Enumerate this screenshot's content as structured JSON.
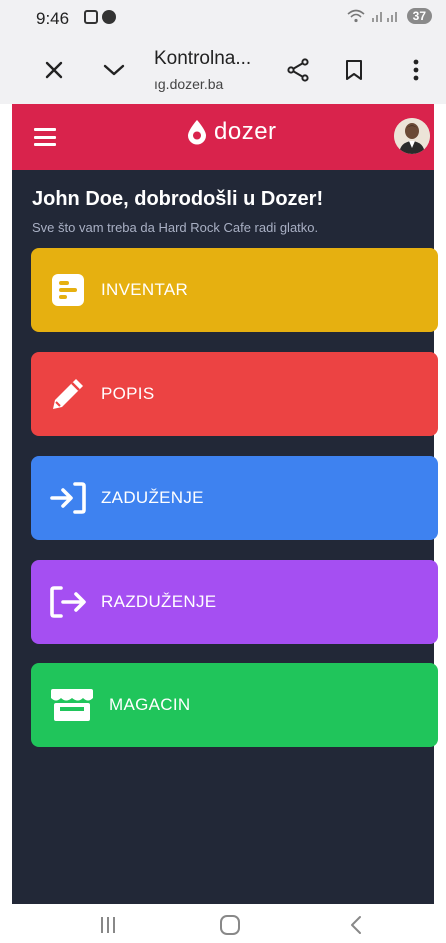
{
  "status_bar": {
    "time": "9:46",
    "battery": "37"
  },
  "browser": {
    "title": "Kontrolna...",
    "url": "ıg.dozer.ba",
    "icons": [
      "close-icon",
      "chevron-down-icon",
      "share-icon",
      "bookmark-icon",
      "more-vert-icon"
    ]
  },
  "app": {
    "logo_text": "dozer",
    "welcome": "John Doe, dobrodošli u Dozer!",
    "subtitle": "Sve što vam treba da Hard Rock Cafe radi glatko.",
    "menu": [
      {
        "label": "INVENTAR",
        "color": "#e6b010",
        "icon": "inventory-icon"
      },
      {
        "label": "POPIS",
        "color": "#ec4343",
        "icon": "pencil-icon"
      },
      {
        "label": "ZADUŽENJE",
        "color": "#3e82f0",
        "icon": "sign-in-icon"
      },
      {
        "label": "RAZDUŽENJE",
        "color": "#a54ff2",
        "icon": "sign-out-icon"
      },
      {
        "label": "MAGACIN",
        "color": "#20c55b",
        "icon": "store-icon"
      }
    ],
    "colors": {
      "header": "#d9234c",
      "background": "#222837"
    }
  }
}
